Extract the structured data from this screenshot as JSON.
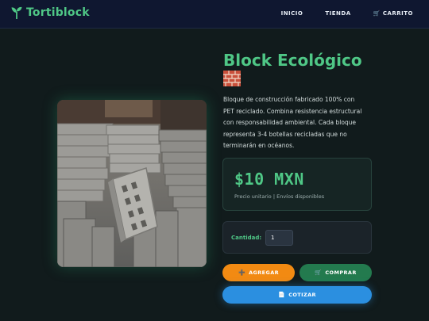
{
  "brand": {
    "name": "Tortiblock",
    "icon": "sprout-icon"
  },
  "nav": {
    "links": [
      {
        "label": "INICIO"
      },
      {
        "label": "TIENDA"
      },
      {
        "label": "CARRITO",
        "icon": "cart-icon"
      }
    ]
  },
  "product": {
    "title": "Block Ecológico",
    "emoji_icon": "brick-icon",
    "description": "Bloque de construcción fabricado 100% con PET reciclado. Combina resistencia estructural con responsabilidad ambiental. Cada bloque representa 3-4 botellas recicladas que no terminarán en océanos.",
    "price": "$10 MXN",
    "price_note": "Precio unitario | Envíos disponibles",
    "quantity_label": "Cantidad:",
    "quantity_value": "1"
  },
  "actions": {
    "add_label": "AGREGAR",
    "add_icon": "plus-icon",
    "buy_label": "COMPRAR",
    "buy_icon": "cart-icon",
    "quote_label": "COTIZAR",
    "quote_icon": "document-icon"
  },
  "colors": {
    "accent_green": "#4fc786",
    "orange": "#f28a12",
    "dark_green": "#237a4e",
    "blue": "#2b8fe0",
    "background": "#111b1c",
    "nav": "#0f1730"
  }
}
